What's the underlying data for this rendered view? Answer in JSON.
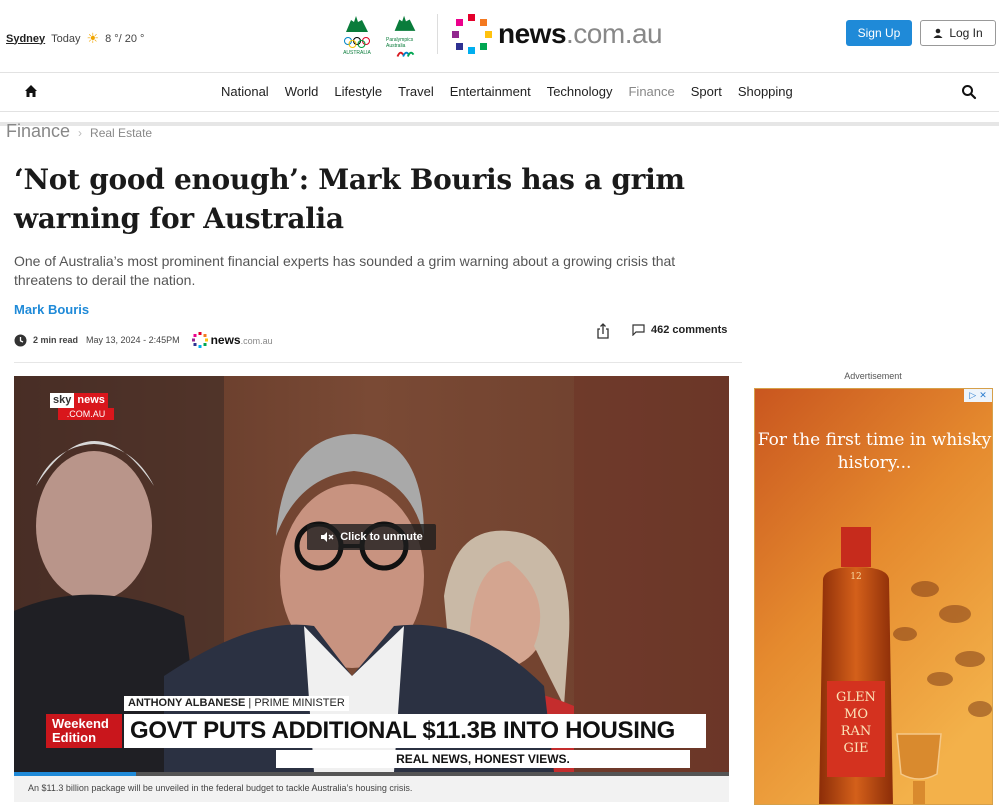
{
  "header": {
    "weather": {
      "city": "Sydney",
      "day": "Today",
      "temps": "8 °/ 20 °",
      "icon": "sun-icon"
    },
    "olympic_logos": [
      {
        "label": "AUSTRALIA"
      },
      {
        "label": "Paralympics Australia"
      }
    ],
    "logo": {
      "main": "news",
      "suffix": ".com.au"
    },
    "signup_label": "Sign Up",
    "login_label": "Log In"
  },
  "nav": {
    "items": [
      {
        "label": "National"
      },
      {
        "label": "World"
      },
      {
        "label": "Lifestyle"
      },
      {
        "label": "Travel"
      },
      {
        "label": "Entertainment"
      },
      {
        "label": "Technology"
      },
      {
        "label": "Finance",
        "active": true
      },
      {
        "label": "Sport"
      },
      {
        "label": "Shopping"
      }
    ]
  },
  "breadcrumb": {
    "section": "Finance",
    "sub": "Real Estate"
  },
  "article": {
    "headline": "‘Not good enough’: Mark Bouris has a grim warning for Australia",
    "standfirst": "One of Australia’s most prominent financial experts has sounded a grim warning about a growing crisis that threatens to derail the nation.",
    "author": "Mark Bouris",
    "read_time": "2 min read",
    "date": "May 13, 2024 - 2:45PM",
    "comments": "462 comments"
  },
  "video": {
    "channel": {
      "sky": "sky",
      "news": "news",
      "domain": ".COM.AU"
    },
    "unmute_label": "Click to unmute",
    "lower_third": {
      "name": "ANTHONY ALBANESE",
      "role": "PRIME MINISTER",
      "edition_line1": "Weekend",
      "edition_line2": "Edition",
      "headline": "GOVT PUTS ADDITIONAL $11.3B INTO HOUSING",
      "tagline": "REAL NEWS, HONEST VIEWS."
    },
    "progress": 0.17,
    "caption": "An $11.3 billion package will be unveiled in the federal budget to tackle Australia’s housing crisis."
  },
  "advert": {
    "label": "Advertisement",
    "headline": "For the first time in whisky history...",
    "bottle_label": [
      "GLEN",
      "MO",
      "RAN",
      "GIE"
    ],
    "age": "12"
  },
  "colors": {
    "accent": "#1f8ad8",
    "sky_red": "#d9161c"
  }
}
